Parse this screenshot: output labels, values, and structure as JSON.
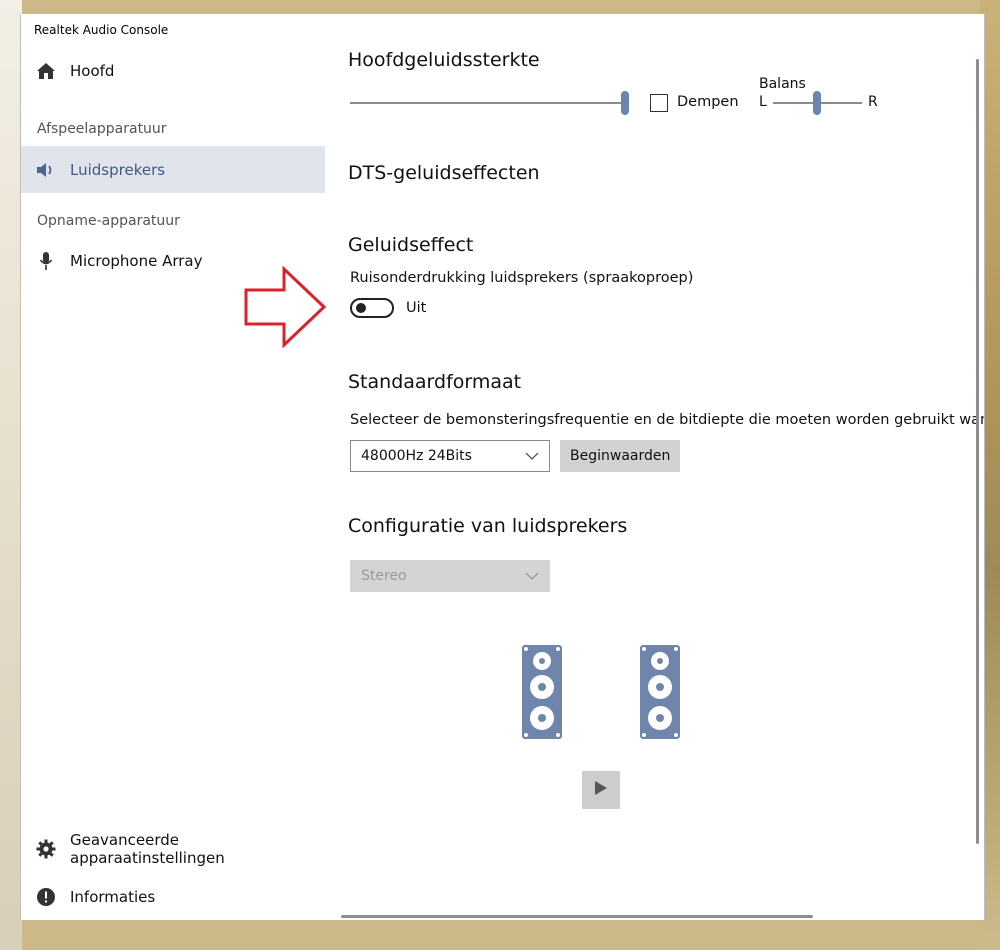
{
  "window": {
    "title": "Realtek Audio Console"
  },
  "sidebar": {
    "home_label": "Hoofd",
    "playback_section": "Afspeelapparatuur",
    "speakers_label": "Luidsprekers",
    "recording_section": "Opname-apparatuur",
    "microphone_label": "Microphone Array",
    "advanced_label": "Geavanceerde apparaatinstellingen",
    "info_label": "Informaties"
  },
  "main": {
    "master_volume": {
      "title": "Hoofdgeluidssterkte",
      "mute_label": "Dempen",
      "mute_checked": false,
      "volume_level": 1.0,
      "balance_label": "Balans",
      "balance_left": "L",
      "balance_right": "R",
      "balance_value": 0.5
    },
    "dts_title": "DTS-geluidseffecten",
    "sound_effect": {
      "title": "Geluidseffect",
      "noise_label": "Ruisonderdrukking luidsprekers (spraakoproep)",
      "toggle_state": "Uit",
      "toggle_on": false
    },
    "default_format": {
      "title": "Standaardformaat",
      "description": "Selecteer de bemonsteringsfrequentie en de bitdiepte die moeten worden gebruikt wanneer u d",
      "selected": "48000Hz 24Bits",
      "reset_label": "Beginwaarden"
    },
    "speaker_config": {
      "title": "Configuratie van luidsprekers",
      "selected": "Stereo",
      "disabled": true
    }
  },
  "colors": {
    "accent": "#6f85ab",
    "selected_bg": "#e1e4ea",
    "annotation_arrow": "#d9232a"
  }
}
